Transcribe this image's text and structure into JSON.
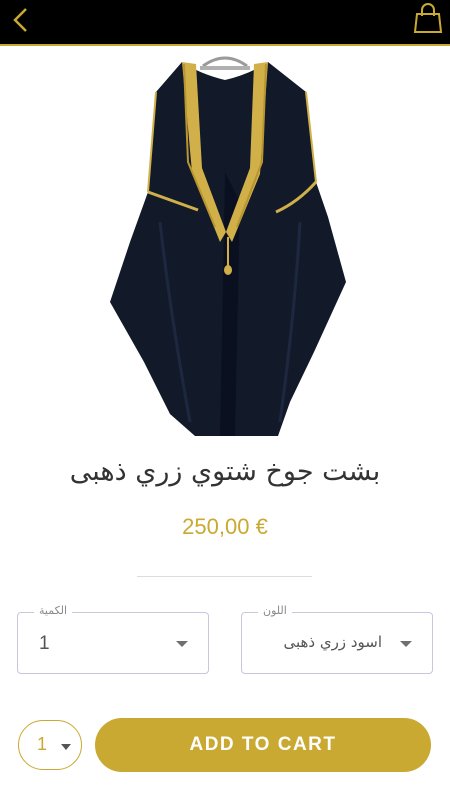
{
  "header": {
    "back_icon": "chevron-left-icon",
    "cart_icon": "shopping-bag-icon"
  },
  "product": {
    "title": "بشت جوخ شتوي زري ذهبى",
    "price": "250,00 €"
  },
  "options": {
    "quantity": {
      "label": "الكمية",
      "value": "1"
    },
    "color": {
      "label": "اللون",
      "value": "اسود زري ذهبى"
    }
  },
  "cart": {
    "quantity_value": "1",
    "button_label": "ADD TO CART"
  },
  "colors": {
    "accent": "#c9a932",
    "topbar": "#000000",
    "title_text": "#333333"
  }
}
